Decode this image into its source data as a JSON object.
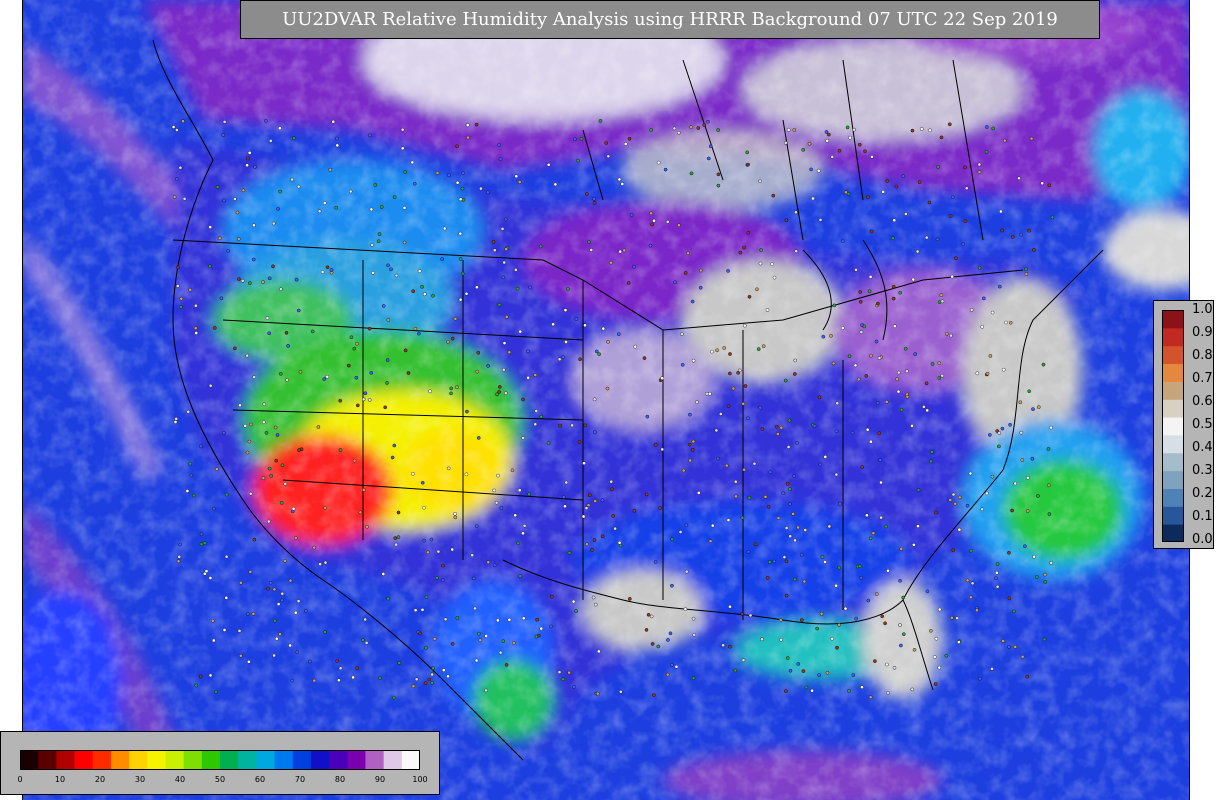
{
  "title": "UU2DVAR Relative Humidity Analysis using HRRR Background 07 UTC 22 Sep 2019",
  "right_colorbar": {
    "ticks": [
      "0.0",
      "0.1",
      "0.2",
      "0.3",
      "0.4",
      "0.5",
      "0.6",
      "0.7",
      "0.8",
      "0.9",
      "1.0"
    ],
    "colors": [
      "#0c2b5c",
      "#27569b",
      "#4f82b6",
      "#7fa3bf",
      "#a5bccc",
      "#d6dee6",
      "#f4f4f4",
      "#d9d0c4",
      "#c6a57c",
      "#e4883e",
      "#d2532c",
      "#c02a23",
      "#8c1118"
    ]
  },
  "bottom_colorbar": {
    "ticks": [
      "0",
      "10",
      "20",
      "30",
      "40",
      "50",
      "60",
      "70",
      "80",
      "90",
      "100"
    ],
    "colors": [
      "#1a0000",
      "#5a0000",
      "#b00000",
      "#ff0000",
      "#ff2a00",
      "#ff8c00",
      "#ffd200",
      "#f4f400",
      "#c8f000",
      "#7ee000",
      "#2cc800",
      "#00b050",
      "#00b4a0",
      "#00a8e0",
      "#0078f0",
      "#0040e0",
      "#1010c8",
      "#4a00b8",
      "#7a00b0",
      "#b060c0",
      "#e0c8e8",
      "#f8f8f8"
    ]
  },
  "colors": {
    "ocean": "#1d3fe0",
    "land_moist": "#6a18c0",
    "saturated": "#c8c8c8",
    "dry": "#f0f000",
    "very_dry": "#ff1a1a",
    "title_bg": "#8c8c8c"
  }
}
